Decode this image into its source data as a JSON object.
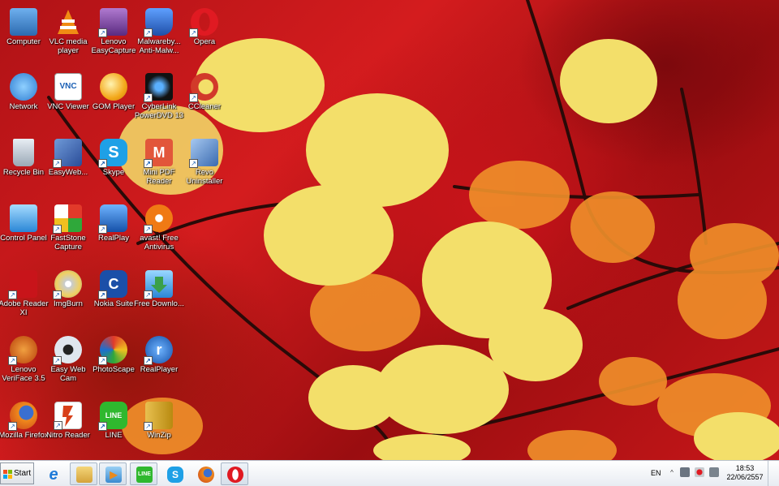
{
  "desktop": {
    "icons": [
      {
        "label": "Computer",
        "icon": "computer-icon",
        "color": "#3d7fc4",
        "glyph": "🖥"
      },
      {
        "label": "VLC media player",
        "icon": "vlc-icon",
        "color": "#f08c14",
        "glyph": "▲"
      },
      {
        "label": "Lenovo EasyCapture",
        "icon": "camera-icon",
        "color": "#7a3a9a",
        "glyph": "◉"
      },
      {
        "label": "Malwareby... Anti-Malw...",
        "icon": "malwarebytes-icon",
        "color": "#1f5fbf",
        "glyph": "M"
      },
      {
        "label": "Opera",
        "icon": "opera-icon",
        "color": "#e01a22",
        "glyph": "O"
      },
      {
        "label": "Network",
        "icon": "network-icon",
        "color": "#2d7bd0",
        "glyph": "◍"
      },
      {
        "label": "VNC Viewer",
        "icon": "vnc-icon",
        "color": "#ffffff",
        "glyph": "VNC"
      },
      {
        "label": "GOM Player",
        "icon": "gom-icon",
        "color": "#f3a81a",
        "glyph": "●"
      },
      {
        "label": "CyberLink PowerDVD 13",
        "icon": "powerdvd-icon",
        "color": "#1a1a1a",
        "glyph": "▶"
      },
      {
        "label": "CCleaner",
        "icon": "ccleaner-icon",
        "color": "#d23a2a",
        "glyph": "C"
      },
      {
        "label": "Recycle Bin",
        "icon": "recycle-bin-icon",
        "color": "#c7d2dc",
        "glyph": "🗑"
      },
      {
        "label": "EasyWeb...",
        "icon": "easyweb-icon",
        "color": "#3a5ca8",
        "glyph": "▦"
      },
      {
        "label": "Skype",
        "icon": "skype-icon",
        "color": "#1ea0e6",
        "glyph": "S"
      },
      {
        "label": "Mini PDF Reader",
        "icon": "pdf-reader-icon",
        "color": "#e2563a",
        "glyph": "M"
      },
      {
        "label": "Revo Uninstaller",
        "icon": "revo-icon",
        "color": "#5f8fcf",
        "glyph": "▣"
      },
      {
        "label": "Control Panel",
        "icon": "control-panel-icon",
        "color": "#2a86d6",
        "glyph": "▤"
      },
      {
        "label": "FastStone Capture",
        "icon": "faststone-icon",
        "color": "#ffffff",
        "glyph": "◆"
      },
      {
        "label": "RealPlay",
        "icon": "realplay-icon",
        "color": "#1c6ed0",
        "glyph": "◌"
      },
      {
        "label": "avast! Free Antivirus",
        "icon": "avast-icon",
        "color": "#f07a14",
        "glyph": "a"
      },
      {
        "label": "Adobe Reader XI",
        "icon": "adobe-reader-icon",
        "color": "#c8141a",
        "glyph": "A"
      },
      {
        "label": "ImgBurn",
        "icon": "imgburn-icon",
        "color": "#b8bcc0",
        "glyph": "◎"
      },
      {
        "label": "Nokia Suite",
        "icon": "nokia-suite-icon",
        "color": "#1b4fa8",
        "glyph": "C"
      },
      {
        "label": "Free Downlo...",
        "icon": "free-download-icon",
        "color": "#3aa04a",
        "glyph": "↓"
      },
      {
        "label": "Lenovo VeriFace 3.5",
        "icon": "veriface-icon",
        "color": "#d0601a",
        "glyph": "☺"
      },
      {
        "label": "Easy Web Cam",
        "icon": "webcam-icon",
        "color": "#e8eef4",
        "glyph": "◉"
      },
      {
        "label": "PhotoScape",
        "icon": "photoscape-icon",
        "color": "#8a8f96",
        "glyph": "✿"
      },
      {
        "label": "RealPlayer",
        "icon": "realplayer-icon",
        "color": "#1c6ed0",
        "glyph": "r"
      },
      {
        "label": "Mozilla Firefox",
        "icon": "firefox-icon",
        "color": "#e06a1a",
        "glyph": "◕"
      },
      {
        "label": "Nitro Reader",
        "icon": "nitro-icon",
        "color": "#d8401a",
        "glyph": "N"
      },
      {
        "label": "LINE",
        "icon": "line-icon",
        "color": "#2fb82e",
        "glyph": "LINE"
      },
      {
        "label": "WinZip",
        "icon": "winzip-icon",
        "color": "#d8a020",
        "glyph": "Z"
      }
    ]
  },
  "taskbar": {
    "start_label": "Start",
    "pinned": [
      {
        "name": "internet-explorer",
        "color": "#1e7ad8",
        "glyph": "e"
      },
      {
        "name": "windows-explorer",
        "color": "#e2b84a",
        "glyph": "▭"
      },
      {
        "name": "media-player",
        "color": "#e98a1c",
        "glyph": "▶"
      },
      {
        "name": "line",
        "color": "#2fb82e",
        "glyph": "LINE"
      },
      {
        "name": "skype",
        "color": "#1ea0e6",
        "glyph": "S"
      },
      {
        "name": "firefox",
        "color": "#e06a1a",
        "glyph": "◕"
      },
      {
        "name": "opera",
        "color": "#e01a22",
        "glyph": "O"
      }
    ],
    "language": "EN",
    "tray_arrow": "^",
    "time": "18:53",
    "date": "22/06/2557"
  }
}
